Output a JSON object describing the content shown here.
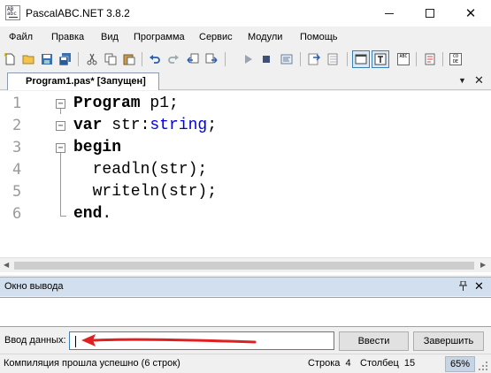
{
  "window": {
    "title": "PascalABC.NET 3.8.2",
    "app_icon_text_1": "AB",
    "app_icon_text_2": "abc",
    "minimize_glyph": "minimize-icon",
    "maximize_glyph": "maximize-icon",
    "close_glyph": "✕"
  },
  "menu": {
    "items": [
      "Файл",
      "Правка",
      "Вид",
      "Программа",
      "Сервис",
      "Модули",
      "Помощь"
    ]
  },
  "toolbar": {
    "icons": [
      "new-file-icon",
      "open-folder-icon",
      "save-icon",
      "save-all-icon",
      "cut-icon",
      "copy-icon",
      "paste-icon",
      "undo-icon",
      "redo-icon",
      "navigate-back-icon",
      "navigate-forward-icon",
      "run-icon",
      "stop-icon",
      "compile-icon",
      "debug-step-icon",
      "debug-step-over-icon",
      "output-window-icon",
      "text-icon",
      "abc-icon",
      "format-icon",
      "code-icon"
    ],
    "abc_text": "ABC",
    "code_text": "CO DE"
  },
  "tabs": {
    "active": "Program1.pas* [Запущен]",
    "bullet": "•",
    "dropdown_glyph": "▼",
    "close_glyph": "✕"
  },
  "editor": {
    "line_numbers": [
      "1",
      "2",
      "3",
      "4",
      "5",
      "6"
    ],
    "lines": [
      {
        "kw": "Program",
        "rest": " p1;"
      },
      {
        "kw": "var",
        "rest": " str:",
        "type": "string",
        "tail": ";"
      },
      {
        "kw": "begin",
        "rest": ""
      },
      {
        "kw": "",
        "rest": "  readln(str);"
      },
      {
        "kw": "",
        "rest": "  writeln(str);"
      },
      {
        "kw": "end",
        "rest": "."
      }
    ],
    "fold_minus": "−"
  },
  "output": {
    "title": "Окно вывода",
    "pin_glyph": "ᚘ",
    "close_glyph": "✕",
    "content": ""
  },
  "input": {
    "label": "Ввод данных:",
    "value": "",
    "enter_button": "Ввести",
    "finish_button": "Завершить"
  },
  "status": {
    "message": "Компиляция прошла успешно (6 строк)",
    "row_label": "Строка",
    "row_value": "4",
    "col_label": "Столбец",
    "col_value": "15",
    "zoom": "65%"
  },
  "colors": {
    "annotation_arrow": "#e02020",
    "type_keyword": "#0000dd",
    "pressed_button": "#3c7fb1"
  }
}
